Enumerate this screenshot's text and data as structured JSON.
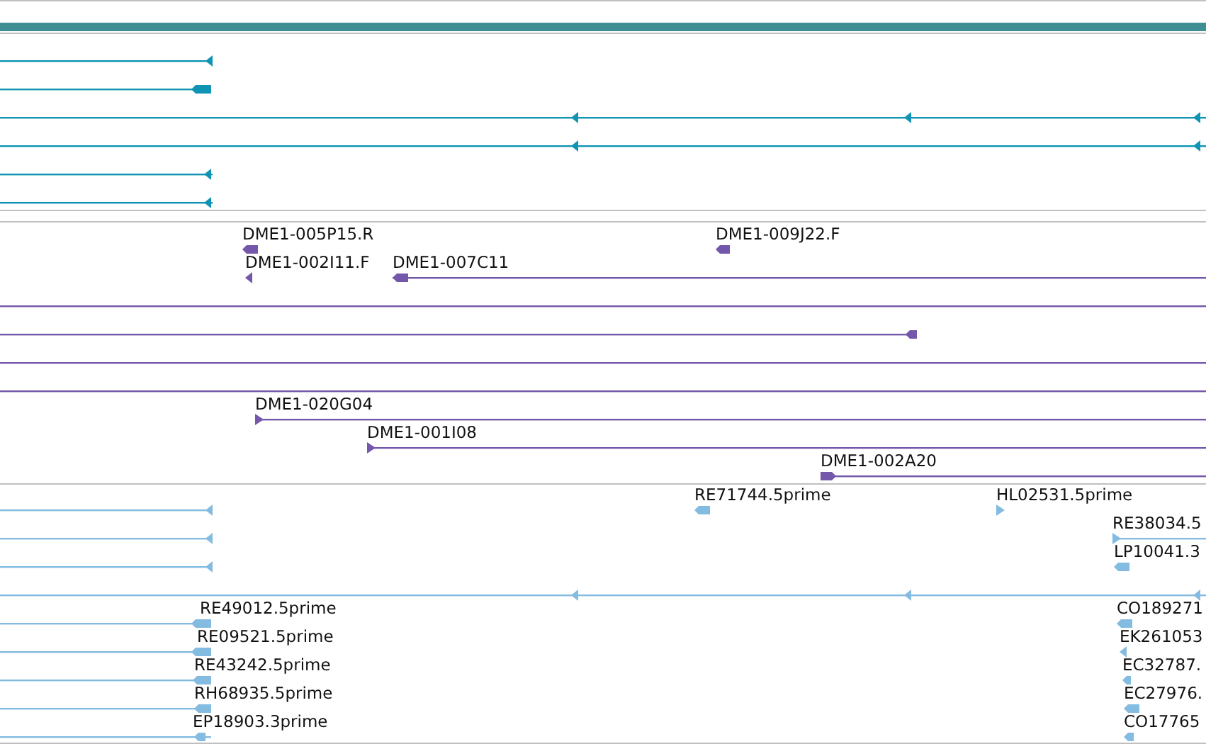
{
  "tracks": [
    {
      "color": "#1094b4",
      "features": [
        {
          "kind": "arrow",
          "reverse": true
        },
        {
          "kind": "arrow",
          "reverse": true
        },
        {
          "kind": "arrow",
          "reverse": true
        },
        {
          "kind": "arrow",
          "reverse": true
        },
        {
          "kind": "arrow",
          "reverse": true
        },
        {
          "kind": "arrow",
          "reverse": true
        }
      ]
    },
    {
      "color": "#7357aa",
      "features": [
        {
          "kind": "arrow",
          "label": "DME1-005P15.R",
          "reverse": true
        },
        {
          "kind": "arrow",
          "label": "DME1-009J22.F",
          "reverse": true
        },
        {
          "kind": "arrow",
          "label": "DME1-002I11.F",
          "reverse": true
        },
        {
          "kind": "arrow",
          "label": "DME1-007C11",
          "reverse": true
        },
        {
          "kind": "plain"
        },
        {
          "kind": "arrow",
          "reverse": true
        },
        {
          "kind": "plain"
        },
        {
          "kind": "plain"
        },
        {
          "kind": "arrow",
          "label": "DME1-020G04",
          "reverse": false
        },
        {
          "kind": "arrow",
          "label": "DME1-001I08",
          "reverse": false
        },
        {
          "kind": "arrow",
          "label": "DME1-002A20",
          "reverse": false
        }
      ]
    },
    {
      "color": "#84bbe0",
      "features": [
        {
          "kind": "arrow",
          "reverse": true
        },
        {
          "kind": "arrow",
          "label": "RE71744.5prime",
          "reverse": true
        },
        {
          "kind": "arrow",
          "label": "HL02531.5prime",
          "reverse": false
        },
        {
          "kind": "arrow",
          "reverse": true
        },
        {
          "kind": "arrow",
          "label": "RE38034.5",
          "reverse": false
        },
        {
          "kind": "arrow",
          "reverse": true
        },
        {
          "kind": "arrow",
          "label": "LP10041.3",
          "reverse": true
        },
        {
          "kind": "arrow",
          "reverse": true
        },
        {
          "kind": "arrow",
          "label": "RE49012.5prime",
          "reverse": true
        },
        {
          "kind": "arrow",
          "label": "CO189271",
          "reverse": true
        },
        {
          "kind": "arrow",
          "label": "RE09521.5prime",
          "reverse": true
        },
        {
          "kind": "arrow",
          "label": "EK261053",
          "reverse": true
        },
        {
          "kind": "arrow",
          "label": "RE43242.5prime",
          "reverse": true
        },
        {
          "kind": "arrow",
          "label": "EC32787.",
          "reverse": true
        },
        {
          "kind": "arrow",
          "label": "RH68935.5prime",
          "reverse": true
        },
        {
          "kind": "arrow",
          "label": "EC27976.",
          "reverse": true
        },
        {
          "kind": "arrow",
          "label": "EP18903.3prime",
          "reverse": true
        },
        {
          "kind": "arrow",
          "label": "CO17765",
          "reverse": true
        }
      ]
    }
  ]
}
